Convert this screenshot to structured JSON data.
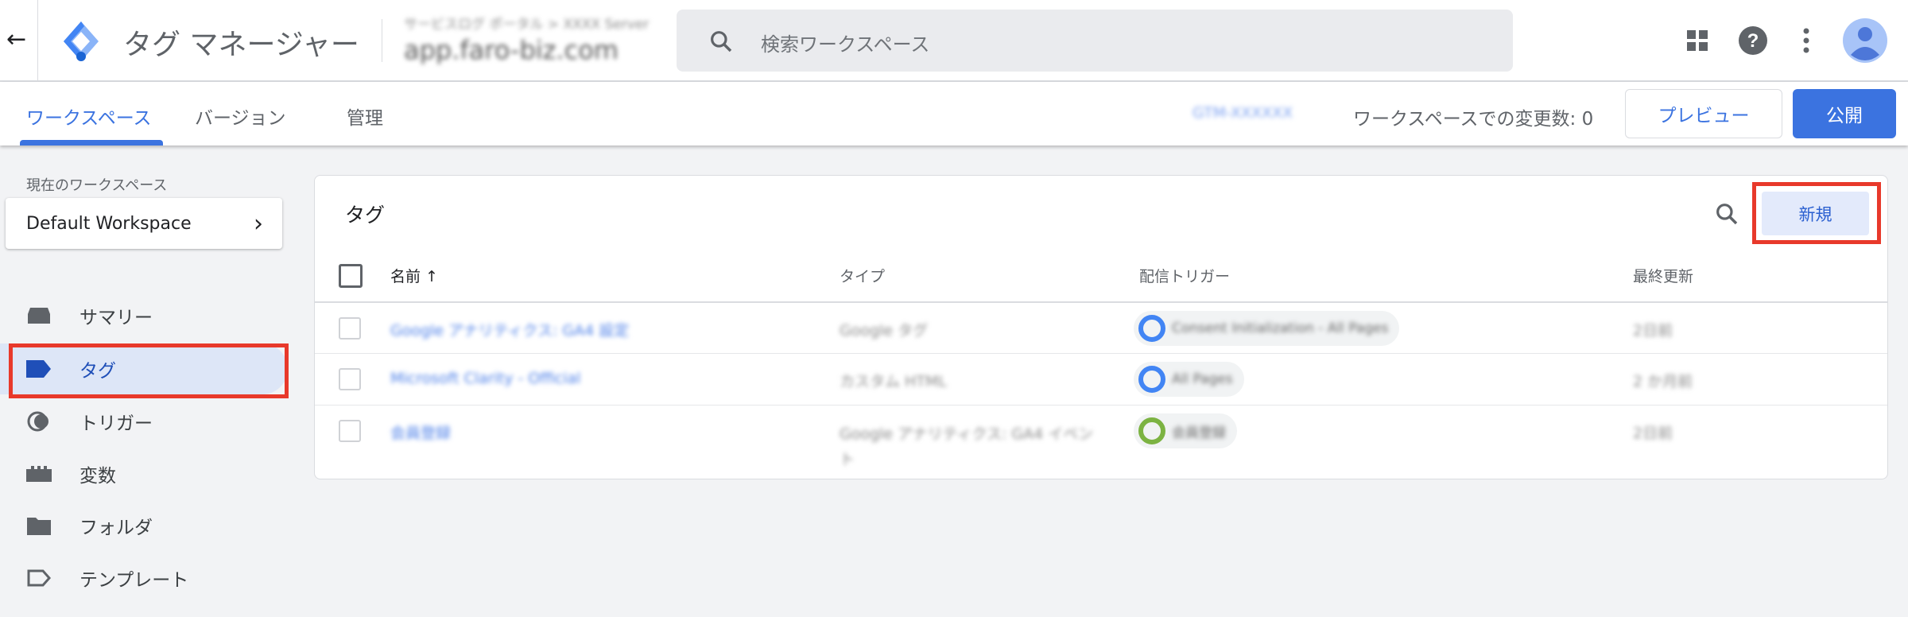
{
  "header": {
    "app_title": "タグ マネージャー",
    "account_name": "サービスログ ポータル > XXXX Server",
    "container_name": "app.faro-biz.com",
    "search_placeholder": "検索ワークスペース"
  },
  "tabs": [
    {
      "label": "ワークスペース",
      "active": true
    },
    {
      "label": "バージョン"
    },
    {
      "label": "管理"
    }
  ],
  "toolbar": {
    "container_id": "GTM-XXXXXX",
    "changes_label": "ワークスペースでの変更数: 0",
    "preview_label": "プレビュー",
    "publish_label": "公開"
  },
  "sidebar": {
    "workspace_caption": "現在のワークスペース",
    "workspace_name": "Default Workspace",
    "items": [
      {
        "label": "サマリー",
        "icon": "summary-icon"
      },
      {
        "label": "タグ",
        "icon": "tag-icon",
        "selected": true
      },
      {
        "label": "トリガー",
        "icon": "trigger-icon"
      },
      {
        "label": "変数",
        "icon": "variable-icon"
      },
      {
        "label": "フォルダ",
        "icon": "folder-icon"
      },
      {
        "label": "テンプレート",
        "icon": "template-icon"
      }
    ]
  },
  "card": {
    "title": "タグ",
    "new_label": "新規",
    "columns": [
      "名前",
      "タイプ",
      "配信トリガー",
      "最終更新"
    ],
    "rows": [
      {
        "name": "Google アナリティクス: GA4 設定",
        "type": "Google タグ",
        "trigger": "Consent Initialization - All Pages",
        "trigger_color": "#4285f4",
        "updated": "2日前"
      },
      {
        "name": "Microsoft Clarity - Official",
        "type": "カスタム HTML",
        "trigger": "All Pages",
        "trigger_color": "#4285f4",
        "updated": "2 か月前"
      },
      {
        "name": "会員登録",
        "type": "Google アナリティクス: GA4 イベント",
        "trigger": "会員登録",
        "trigger_color": "#7cb342",
        "updated": "2日前"
      }
    ]
  },
  "colors": {
    "accent": "#3b73e0",
    "highlight": "#e8392b"
  }
}
